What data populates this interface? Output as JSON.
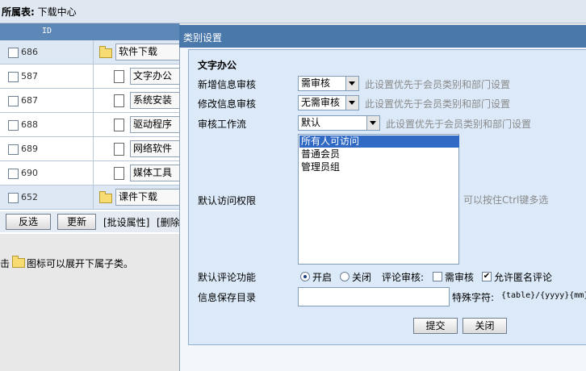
{
  "topbar": {
    "prefix": "所属表:",
    "value": "下载中心"
  },
  "table": {
    "header_id": "ID",
    "rows": [
      {
        "id": "686",
        "name": "软件下载",
        "type": "folder"
      },
      {
        "id": "587",
        "name": "文字办公",
        "type": "doc"
      },
      {
        "id": "687",
        "name": "系统安装",
        "type": "doc"
      },
      {
        "id": "688",
        "name": "驱动程序",
        "type": "doc"
      },
      {
        "id": "689",
        "name": "网络软件",
        "type": "doc"
      },
      {
        "id": "690",
        "name": "媒体工具",
        "type": "doc"
      },
      {
        "id": "652",
        "name": "课件下载",
        "type": "folder"
      }
    ],
    "btn_invert": "反选",
    "btn_update": "更新",
    "link_batch": "[批设属性]",
    "link_delete": "[删除"
  },
  "hint": {
    "pre": "击",
    "post": "图标可以展开下属子类。"
  },
  "dialog": {
    "title": "类别设置",
    "section_title": "文字办公",
    "fields": {
      "add_review_label": "新增信息审核",
      "add_review_value": "需审核",
      "add_review_note": "此设置优先于会员类别和部门设置",
      "edit_review_label": "修改信息审核",
      "edit_review_value": "无需审核",
      "edit_review_note": "此设置优先于会员类别和部门设置",
      "workflow_label": "审核工作流",
      "workflow_value": "默认",
      "workflow_note": "此设置优先于会员类别和部门设置",
      "access_label": "默认访问权限",
      "access_options": [
        "所有人可访问",
        "普通会员",
        "管理员组"
      ],
      "access_note": "可以按住Ctrl键多选",
      "comment_label": "默认评论功能",
      "comment_on": "开启",
      "comment_off": "关闭",
      "comment_review_label": "评论审核:",
      "comment_need_review": "需审核",
      "comment_anonymous": "允许匿名评论",
      "dir_label": "信息保存目录",
      "dir_value": "",
      "special_label": "特殊字符:",
      "special_value": "{table}/{yyyy}{mm}"
    },
    "submit": "提交",
    "close": "关闭"
  }
}
